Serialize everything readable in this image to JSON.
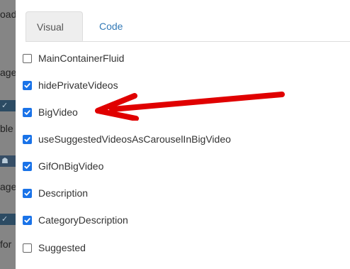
{
  "background": {
    "fragments": [
      "oad",
      "age",
      "ble",
      "age",
      "for"
    ]
  },
  "tabs": [
    {
      "label": "Visual"
    },
    {
      "label": "Code"
    }
  ],
  "options": [
    {
      "label": "MainContainerFluid",
      "checked": false
    },
    {
      "label": "hidePrivateVideos",
      "checked": true
    },
    {
      "label": "BigVideo",
      "checked": true
    },
    {
      "label": "useSuggestedVideosAsCarouselInBigVideo",
      "checked": true
    },
    {
      "label": "GifOnBigVideo",
      "checked": true
    },
    {
      "label": "Description",
      "checked": true
    },
    {
      "label": "CategoryDescription",
      "checked": true
    },
    {
      "label": "Suggested",
      "checked": false
    }
  ],
  "colors": {
    "checkbox_checked": "#1a73e8",
    "arrow": "#e00000",
    "link": "#337ab7"
  }
}
